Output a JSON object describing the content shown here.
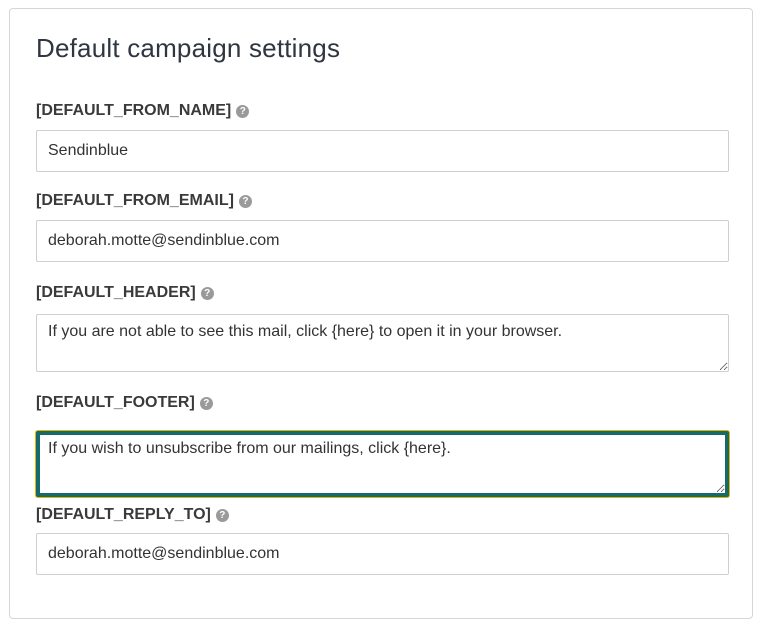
{
  "title": "Default campaign settings",
  "fields": [
    {
      "label": "[DEFAULT_FROM_NAME]",
      "value": "Sendinblue"
    },
    {
      "label": "[DEFAULT_FROM_EMAIL]",
      "value": "deborah.motte@sendinblue.com"
    },
    {
      "label": "[DEFAULT_HEADER]",
      "value": "If you are not able to see this mail, click {here} to open it in your browser."
    },
    {
      "label": "[DEFAULT_FOOTER]",
      "value": "If you wish to unsubscribe from our mailings, click {here}."
    },
    {
      "label": "[DEFAULT_REPLY_TO]",
      "value": "deborah.motte@sendinblue.com"
    }
  ],
  "help_icon_glyph": "?",
  "colors": {
    "focus_border": "#166a69",
    "focus_ring": "#e0b800"
  },
  "icons": {
    "help": "question-circle-icon"
  }
}
